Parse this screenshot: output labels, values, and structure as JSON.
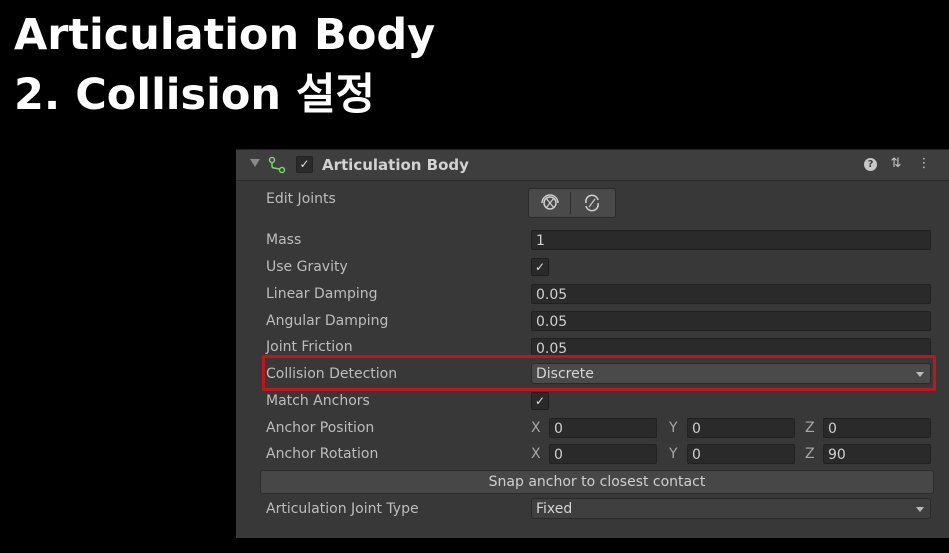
{
  "overlay": {
    "title_line1": "Articulation Body",
    "title_line2": "2. Collision 설정"
  },
  "component": {
    "title": "Articulation Body",
    "enabled": true,
    "accent_icon_color": "#7bd36b"
  },
  "fields": {
    "edit_joints_label": "Edit Joints",
    "mass_label": "Mass",
    "mass_value": "1",
    "use_gravity_label": "Use Gravity",
    "use_gravity_checked": "✓",
    "linear_damping_label": "Linear Damping",
    "linear_damping_value": "0.05",
    "angular_damping_label": "Angular Damping",
    "angular_damping_value": "0.05",
    "joint_friction_label": "Joint Friction",
    "joint_friction_value": "0.05",
    "collision_detection_label": "Collision Detection",
    "collision_detection_value": "Discrete",
    "match_anchors_label": "Match Anchors",
    "match_anchors_checked": "✓",
    "anchor_position_label": "Anchor Position",
    "anchor_position": {
      "x_label": "X",
      "x": "0",
      "y_label": "Y",
      "y": "0",
      "z_label": "Z",
      "z": "0"
    },
    "anchor_rotation_label": "Anchor Rotation",
    "anchor_rotation": {
      "x_label": "X",
      "x": "0",
      "y_label": "Y",
      "y": "0",
      "z_label": "Z",
      "z": "90"
    },
    "snap_button_label": "Snap anchor to closest contact",
    "joint_type_label": "Articulation Joint Type",
    "joint_type_value": "Fixed"
  },
  "highlight_color": "#c0151b"
}
